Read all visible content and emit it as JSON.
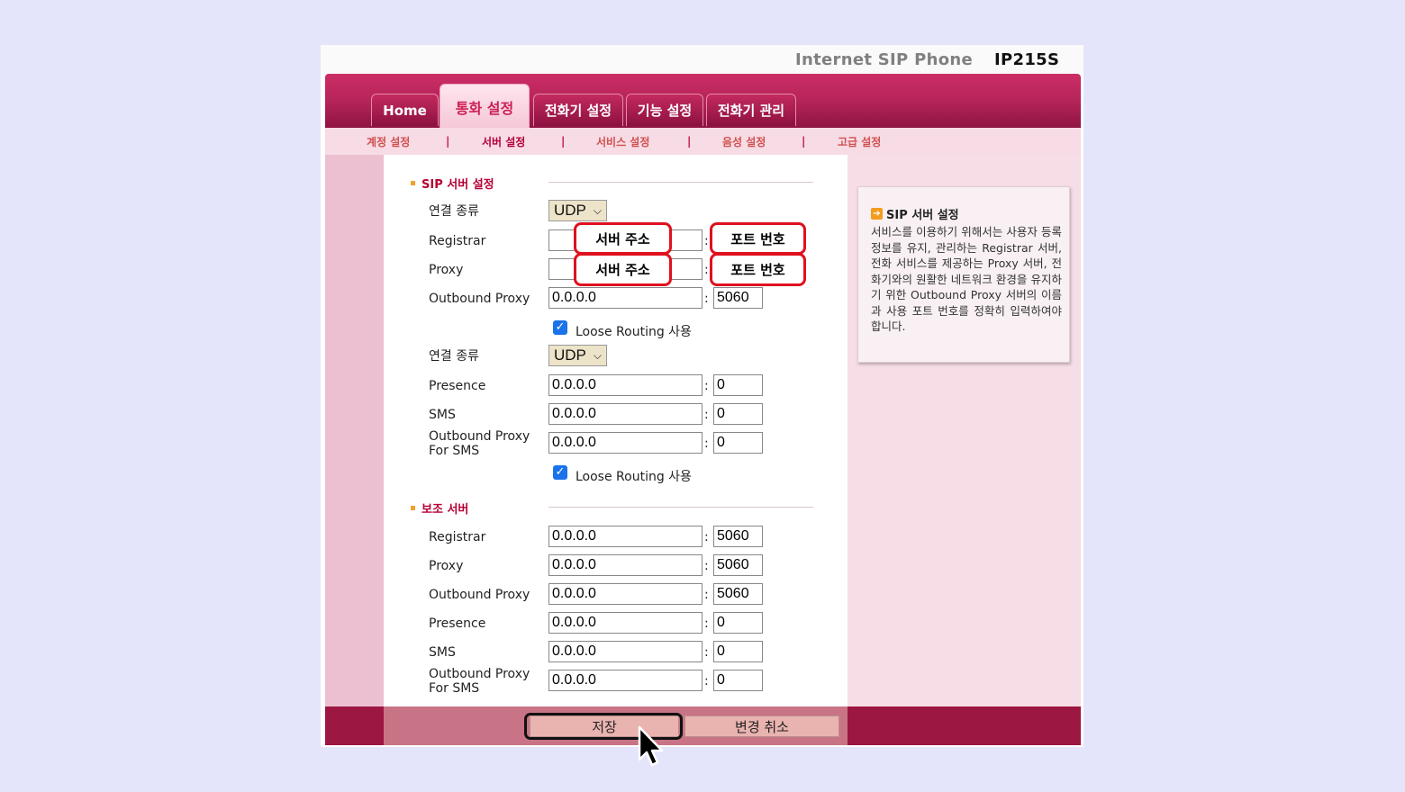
{
  "device": {
    "name": "Internet SIP Phone",
    "model": "IP215S"
  },
  "tabs": [
    {
      "label": "Home"
    },
    {
      "label": "통화 설정",
      "active": true
    },
    {
      "label": "전화기 설정"
    },
    {
      "label": "기능 설정"
    },
    {
      "label": "전화기 관리"
    }
  ],
  "subnav": [
    "계정 설정",
    "서버 설정",
    "서비스 설정",
    "음성 설정",
    "고급 설정"
  ],
  "subnav_separator": "|",
  "sip_section": {
    "title": "SIP 서버 설정",
    "conn_type_label": "연결 종류",
    "conn_type_value": "UDP",
    "registrar_label": "Registrar",
    "proxy_label": "Proxy",
    "outbound_proxy_label": "Outbound Proxy",
    "outbound_proxy_value": "0.0.0.0",
    "outbound_proxy_port": "5060",
    "loose_routing_label": "Loose Routing 사용",
    "conn_type2_label": "연결 종류",
    "conn_type2_value": "UDP",
    "presence_label": "Presence",
    "presence_value": "0.0.0.0",
    "presence_port": "0",
    "sms_label": "SMS",
    "sms_value": "0.0.0.0",
    "sms_port": "0",
    "outbound_sms_label_1": "Outbound Proxy",
    "outbound_sms_label_2": "For SMS",
    "outbound_sms_value": "0.0.0.0",
    "outbound_sms_port": "0",
    "loose_routing2_label": "Loose Routing 사용"
  },
  "callouts": {
    "server_address": "서버 주소",
    "port_number": "포트 번호"
  },
  "backup_section": {
    "title": "보조 서버",
    "registrar_label": "Registrar",
    "registrar_value": "0.0.0.0",
    "registrar_port": "5060",
    "proxy_label": "Proxy",
    "proxy_value": "0.0.0.0",
    "proxy_port": "5060",
    "outbound_proxy_label": "Outbound Proxy",
    "outbound_proxy_value": "0.0.0.0",
    "outbound_proxy_port": "5060",
    "presence_label": "Presence",
    "presence_value": "0.0.0.0",
    "presence_port": "0",
    "sms_label": "SMS",
    "sms_value": "0.0.0.0",
    "sms_port": "0",
    "outbound_sms_label_1": "Outbound Proxy",
    "outbound_sms_label_2": "For SMS",
    "outbound_sms_value": "0.0.0.0",
    "outbound_sms_port": "0"
  },
  "help": {
    "title": "SIP 서버 설정",
    "body": "서비스를 이용하기 위해서는 사용자 등록 정보를 유지, 관리하는 Registrar 서버, 전화 서비스를 제공하는 Proxy 서버, 전화기와의 원활한 네트워크 환경을 유지하기 위한 Outbound Proxy 서버의 이름과 사용 포트 번호를 정확히 입력하여야 합니다."
  },
  "buttons": {
    "save": "저장",
    "cancel": "변경 취소"
  },
  "colors": {
    "brand": "#b6245a",
    "footer": "#9c1742",
    "callout": "#e0101e"
  }
}
